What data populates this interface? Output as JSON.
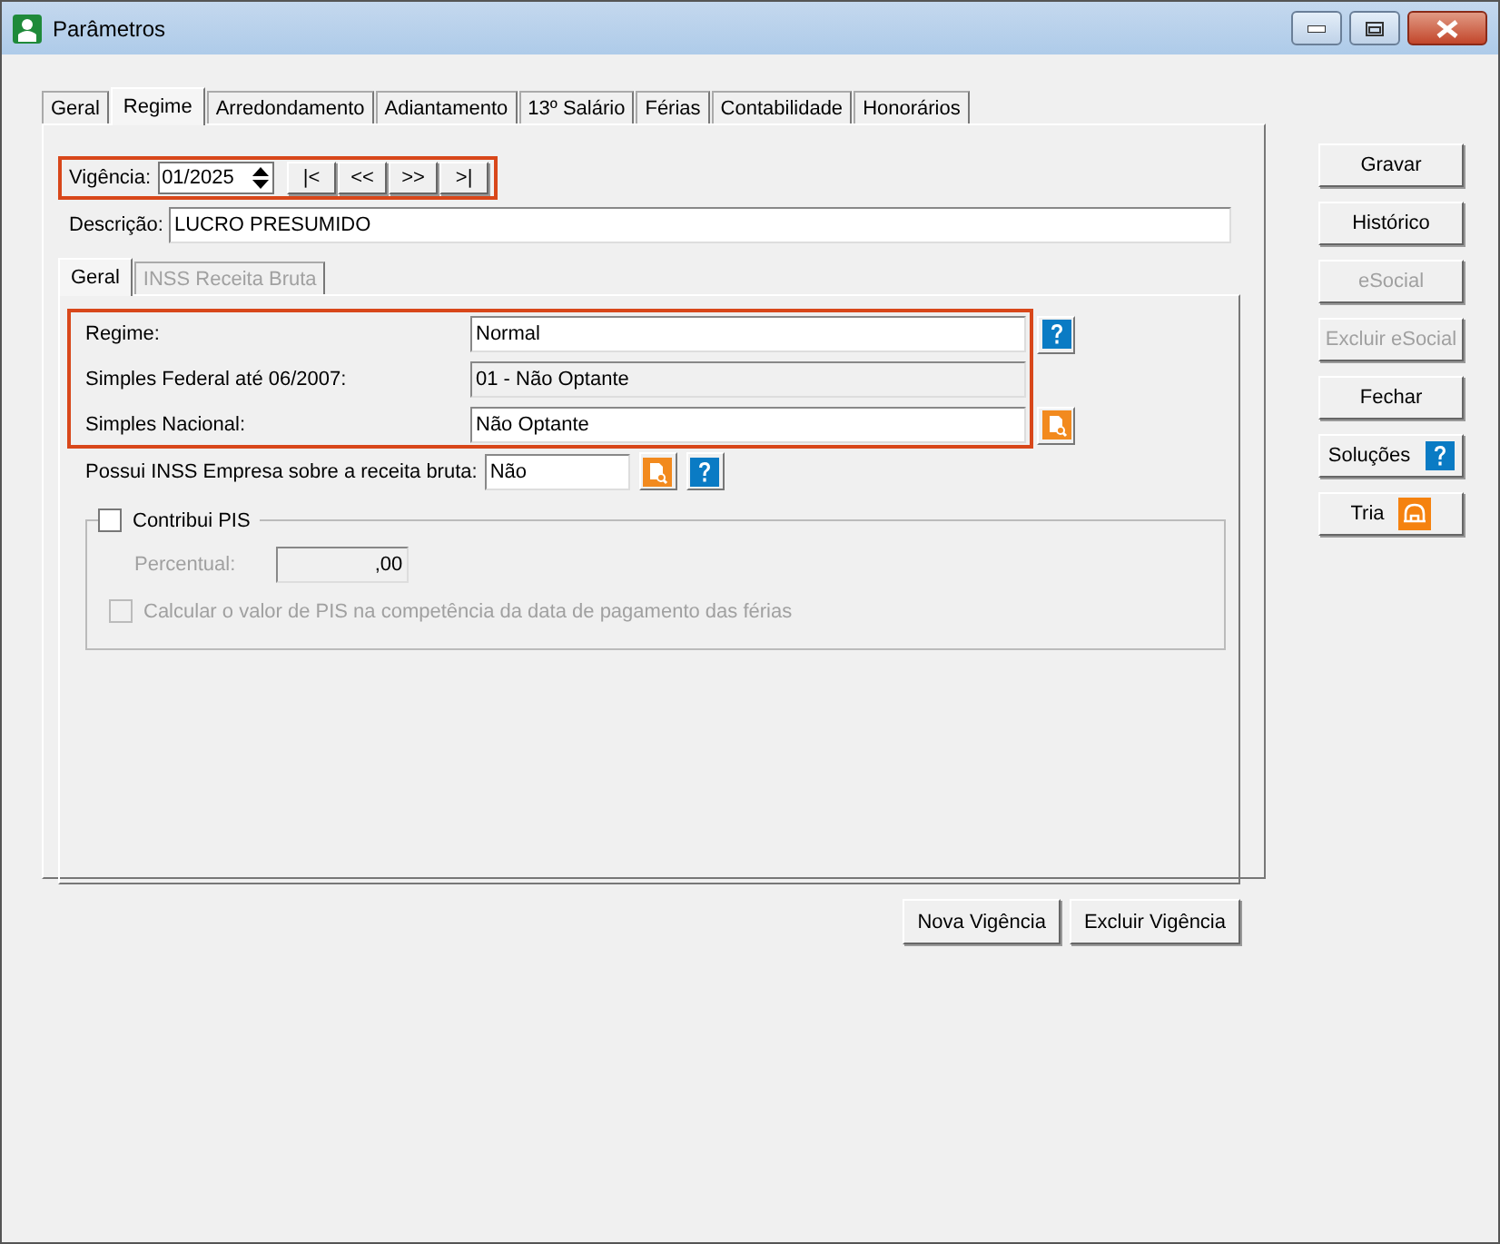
{
  "window": {
    "title": "Parâmetros"
  },
  "tabs": [
    {
      "label": "Geral",
      "selected": false
    },
    {
      "label": "Regime",
      "selected": true
    },
    {
      "label": "Arredondamento",
      "selected": false
    },
    {
      "label": "Adiantamento",
      "selected": false
    },
    {
      "label": "13º Salário",
      "selected": false
    },
    {
      "label": "Férias",
      "selected": false
    },
    {
      "label": "Contabilidade",
      "selected": false
    },
    {
      "label": "Honorários",
      "selected": false
    }
  ],
  "vigencia": {
    "label": "Vigência:",
    "value": "01/2025",
    "nav_buttons": [
      "|<",
      "<<",
      ">>",
      ">|"
    ]
  },
  "descricao": {
    "label": "Descrição:",
    "value": "LUCRO PRESUMIDO"
  },
  "subtabs": [
    {
      "label": "Geral",
      "selected": true,
      "disabled": false
    },
    {
      "label": "INSS Receita Bruta",
      "selected": false,
      "disabled": true
    }
  ],
  "fields": [
    {
      "label": "Regime:",
      "value": "Normal",
      "disabled": false,
      "kind": "help"
    },
    {
      "label": "Simples Federal até 06/2007:",
      "value": "01 - Não Optante",
      "disabled": true,
      "kind": "plain"
    },
    {
      "label": "Simples Nacional:",
      "value": "Não Optante",
      "disabled": false,
      "kind": "lookup"
    }
  ],
  "inss": {
    "label": "Possui INSS Empresa sobre a receita bruta:",
    "value": "Não"
  },
  "pis_group": {
    "label": "Contribui PIS",
    "checked": false,
    "disabled": true,
    "percentual_label": "Percentual:",
    "percentual_value": ",00",
    "calc_label": "Calcular o valor de PIS na competência da data de pagamento das férias",
    "calc_checked": false
  },
  "bottom_buttons": [
    "Nova Vigência",
    "Excluir Vigência"
  ],
  "side_buttons": [
    {
      "label": "Gravar",
      "disabled": false,
      "kind": "plain"
    },
    {
      "label": "Histórico",
      "disabled": false,
      "kind": "plain"
    },
    {
      "label": "eSocial",
      "disabled": true,
      "kind": "plain"
    },
    {
      "label": "Excluir eSocial",
      "disabled": true,
      "kind": "plain"
    },
    {
      "label": "Fechar",
      "disabled": false,
      "kind": "plain"
    },
    {
      "label": "Soluções",
      "disabled": false,
      "kind": "help"
    },
    {
      "label": "Tria",
      "disabled": false,
      "kind": "tria"
    }
  ]
}
